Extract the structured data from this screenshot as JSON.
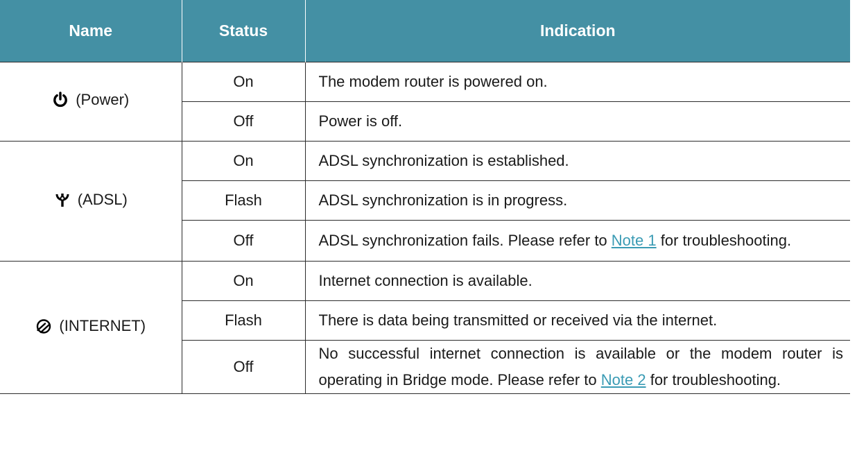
{
  "header": {
    "name": "Name",
    "status": "Status",
    "indication": "Indication"
  },
  "colors": {
    "header_bg": "#4490a4",
    "link": "#3a9bb4"
  },
  "groups": [
    {
      "icon": "power-icon",
      "label": "(Power)",
      "rows": [
        {
          "status": "On",
          "indication": "The modem router is powered on."
        },
        {
          "status": "Off",
          "indication": "Power is off."
        }
      ]
    },
    {
      "icon": "adsl-icon",
      "label": "(ADSL)",
      "rows": [
        {
          "status": "On",
          "indication": "ADSL synchronization is established."
        },
        {
          "status": "Flash",
          "indication": "ADSL synchronization is in progress."
        },
        {
          "status": "Off",
          "pre": "ADSL synchronization fails. Please refer to",
          "link": "Note 1",
          "post": "for troubleshooting."
        }
      ]
    },
    {
      "icon": "internet-icon",
      "label": "(INTERNET)",
      "rows": [
        {
          "status": "On",
          "indication": "Internet connection is available."
        },
        {
          "status": "Flash",
          "indication": "There is data being transmitted or received via the internet."
        },
        {
          "status": "Off",
          "pre": "No successful internet connection is available or the modem router is operating in Bridge mode. Please refer to",
          "link": "Note 2",
          "post": "for troubleshooting."
        }
      ]
    }
  ]
}
